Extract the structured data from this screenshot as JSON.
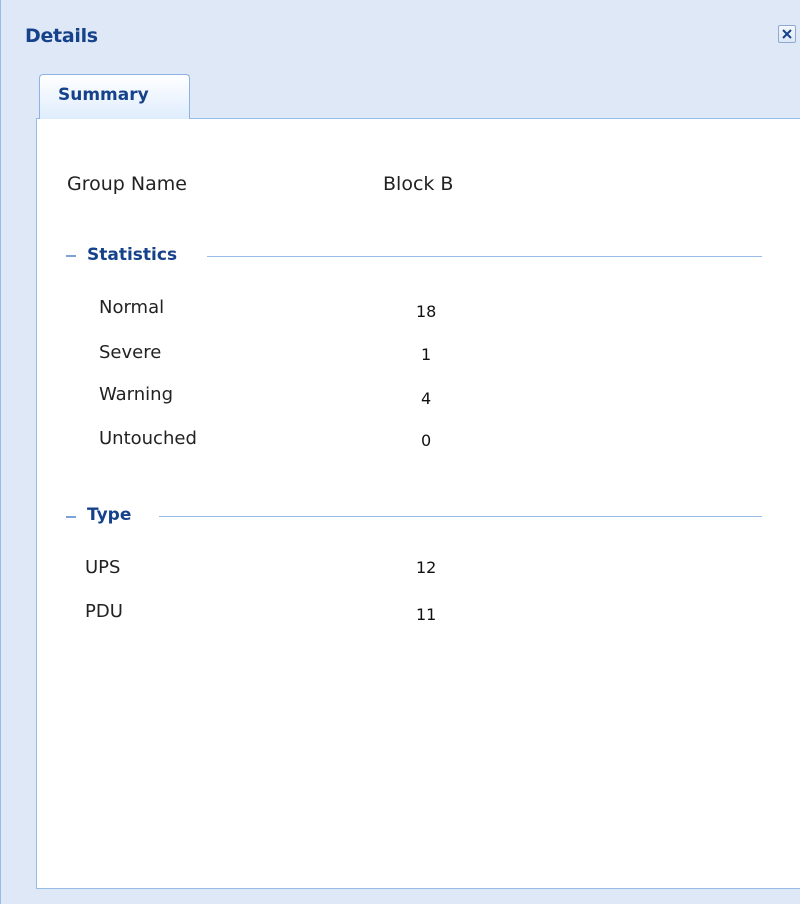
{
  "panel": {
    "title": "Details",
    "close_icon": "close-icon"
  },
  "tabs": [
    {
      "label": "Summary",
      "active": true
    }
  ],
  "summary": {
    "group_name_label": "Group Name",
    "group_name_value": "Block B",
    "statistics": {
      "title": "Statistics",
      "rows": [
        {
          "label": "Normal",
          "value": "18"
        },
        {
          "label": "Severe",
          "value": "1"
        },
        {
          "label": "Warning",
          "value": "4"
        },
        {
          "label": "Untouched",
          "value": "0"
        }
      ]
    },
    "type": {
      "title": "Type",
      "rows": [
        {
          "label": "UPS",
          "value": "12"
        },
        {
          "label": "PDU",
          "value": "11"
        }
      ]
    }
  },
  "colors": {
    "header_background": "#dfe8f6",
    "title_text": "#15428b",
    "border": "#99bbe8"
  }
}
